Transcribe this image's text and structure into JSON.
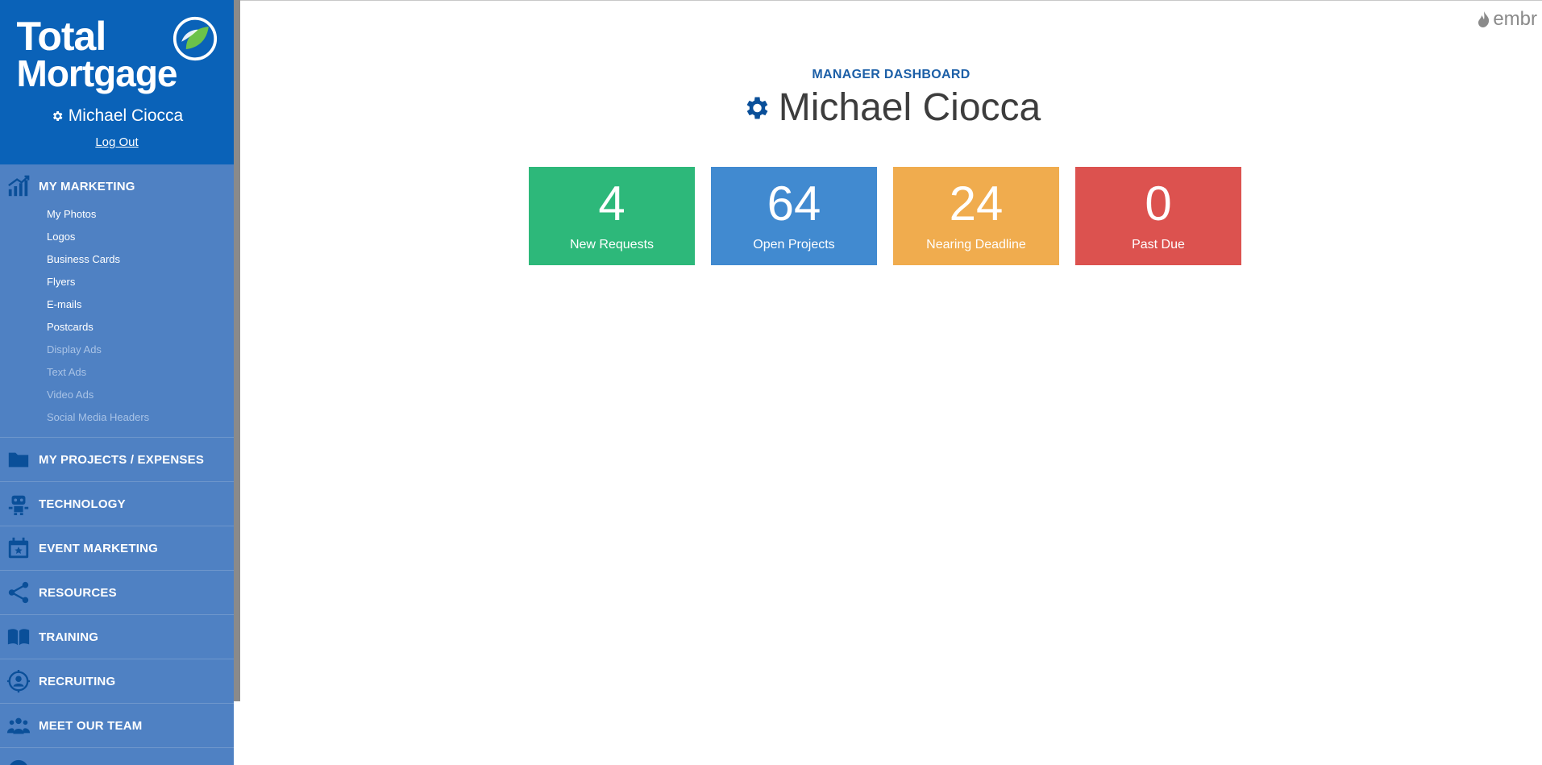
{
  "brand": {
    "logo_line1": "Total",
    "logo_line2": "Mortgage",
    "embr": "embr"
  },
  "user": {
    "name": "Michael Ciocca",
    "logout_label": "Log Out"
  },
  "sidebar": {
    "sections": [
      {
        "label": "MY MARKETING",
        "icon": "chart-growth-icon",
        "items": [
          {
            "label": "My Photos",
            "enabled": true
          },
          {
            "label": "Logos",
            "enabled": true
          },
          {
            "label": "Business Cards",
            "enabled": true
          },
          {
            "label": "Flyers",
            "enabled": true
          },
          {
            "label": "E-mails",
            "enabled": true
          },
          {
            "label": "Postcards",
            "enabled": true
          },
          {
            "label": "Display Ads",
            "enabled": false
          },
          {
            "label": "Text Ads",
            "enabled": false
          },
          {
            "label": "Video Ads",
            "enabled": false
          },
          {
            "label": "Social Media Headers",
            "enabled": false
          }
        ]
      },
      {
        "label": "MY PROJECTS / EXPENSES",
        "icon": "folder-icon"
      },
      {
        "label": "TECHNOLOGY",
        "icon": "robot-icon"
      },
      {
        "label": "EVENT MARKETING",
        "icon": "calendar-star-icon"
      },
      {
        "label": "RESOURCES",
        "icon": "share-icon"
      },
      {
        "label": "TRAINING",
        "icon": "book-icon"
      },
      {
        "label": "RECRUITING",
        "icon": "target-person-icon"
      },
      {
        "label": "MEET OUR TEAM",
        "icon": "team-icon"
      }
    ]
  },
  "dashboard": {
    "label": "MANAGER DASHBOARD",
    "title": "Michael Ciocca",
    "cards": [
      {
        "value": "4",
        "label": "New Requests",
        "color": "#2db87a"
      },
      {
        "value": "64",
        "label": "Open Projects",
        "color": "#418ad0"
      },
      {
        "value": "24",
        "label": "Nearing Deadline",
        "color": "#f0ac4e"
      },
      {
        "value": "0",
        "label": "Past Due",
        "color": "#dc524f"
      }
    ]
  },
  "colors": {
    "sidebar_header": "#0a62b8",
    "sidebar_body": "#4f81c3",
    "icon_blue": "#0a4f99",
    "logo_green": "#6cc24a"
  }
}
